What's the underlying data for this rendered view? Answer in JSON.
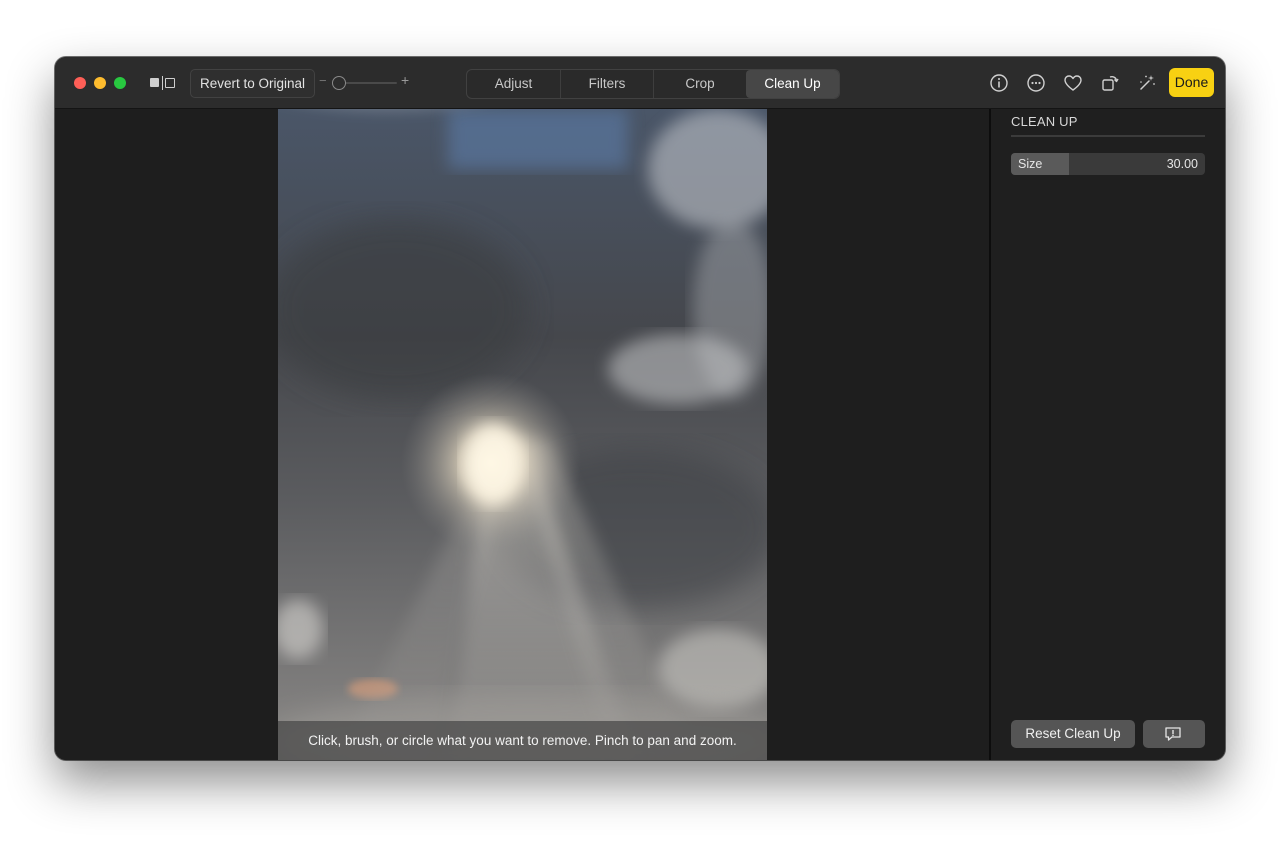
{
  "window": {
    "traffic_lights": [
      "close",
      "minimize",
      "zoom"
    ],
    "colors": {
      "close": "#fe5f57",
      "minimize": "#febc2e",
      "zoom": "#28c840"
    }
  },
  "toolbar": {
    "compare_icon": "before-after-icon",
    "revert_label": "Revert to Original",
    "zoom_minus": "−",
    "zoom_plus": "+",
    "zoom_level": 0,
    "tabs": [
      {
        "label": "Adjust",
        "active": false
      },
      {
        "label": "Filters",
        "active": false
      },
      {
        "label": "Crop",
        "active": false
      },
      {
        "label": "Clean Up",
        "active": true
      }
    ],
    "icons": [
      "info-icon",
      "more-icon",
      "heart-icon",
      "rotate-icon",
      "magic-wand-icon"
    ],
    "done_label": "Done",
    "done_color": "#f8d112"
  },
  "canvas": {
    "image": "cloudy sky with sunbeams",
    "hint": "Click, brush, or circle what you want to remove. Pinch to pan and zoom."
  },
  "sidebar": {
    "title": "CLEAN UP",
    "size_label": "Size",
    "size_value": "30.00",
    "size_fraction": 0.3,
    "reset_label": "Reset Clean Up",
    "feedback_icon": "feedback-icon"
  }
}
